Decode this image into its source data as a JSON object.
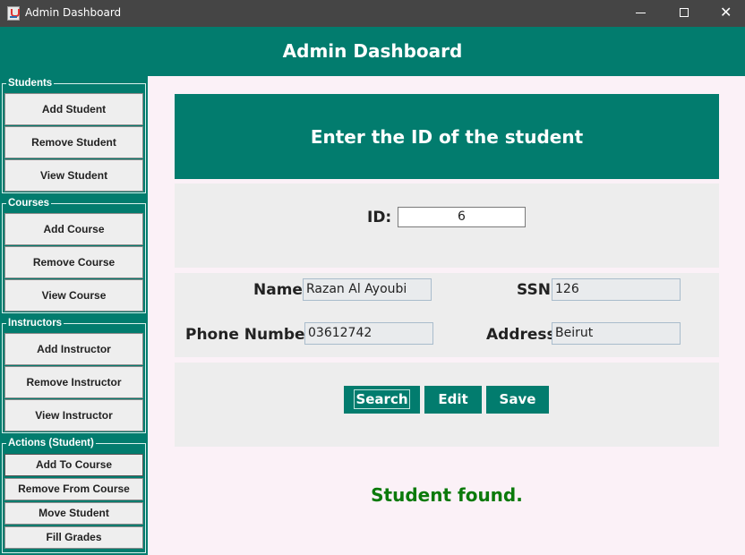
{
  "window": {
    "title": "Admin Dashboard",
    "close_glyph": "✕"
  },
  "header": {
    "title": "Admin Dashboard"
  },
  "sidebar": {
    "students": {
      "legend": "Students",
      "items": [
        "Add Student",
        "Remove Student",
        "View Student"
      ]
    },
    "courses": {
      "legend": "Courses",
      "items": [
        "Add Course",
        "Remove Course",
        "View Course"
      ]
    },
    "instructors": {
      "legend": "Instructors",
      "items": [
        "Add Instructor",
        "Remove Instructor",
        "View Instructor"
      ]
    },
    "actions": {
      "legend": "Actions (Student)",
      "items": [
        "Add To Course",
        "Remove From Course",
        "Move Student",
        "Fill Grades"
      ]
    }
  },
  "main": {
    "banner_title": "Enter the ID of the student",
    "id_label": "ID:",
    "id_value": "6",
    "name_label": "Name",
    "name_value": "Razan Al Ayoubi",
    "ssn_label": "SSN",
    "ssn_value": "126",
    "phone_label": "Phone Number",
    "phone_value": "03612742",
    "address_label": "Address",
    "address_value": "Beirut",
    "buttons": {
      "search": "Search",
      "edit": "Edit",
      "save": "Save"
    },
    "status": "Student found."
  },
  "colors": {
    "accent": "#027c6e",
    "status_green": "#0b7a0b",
    "background": "#fbf1f7",
    "panel": "#ededed"
  }
}
